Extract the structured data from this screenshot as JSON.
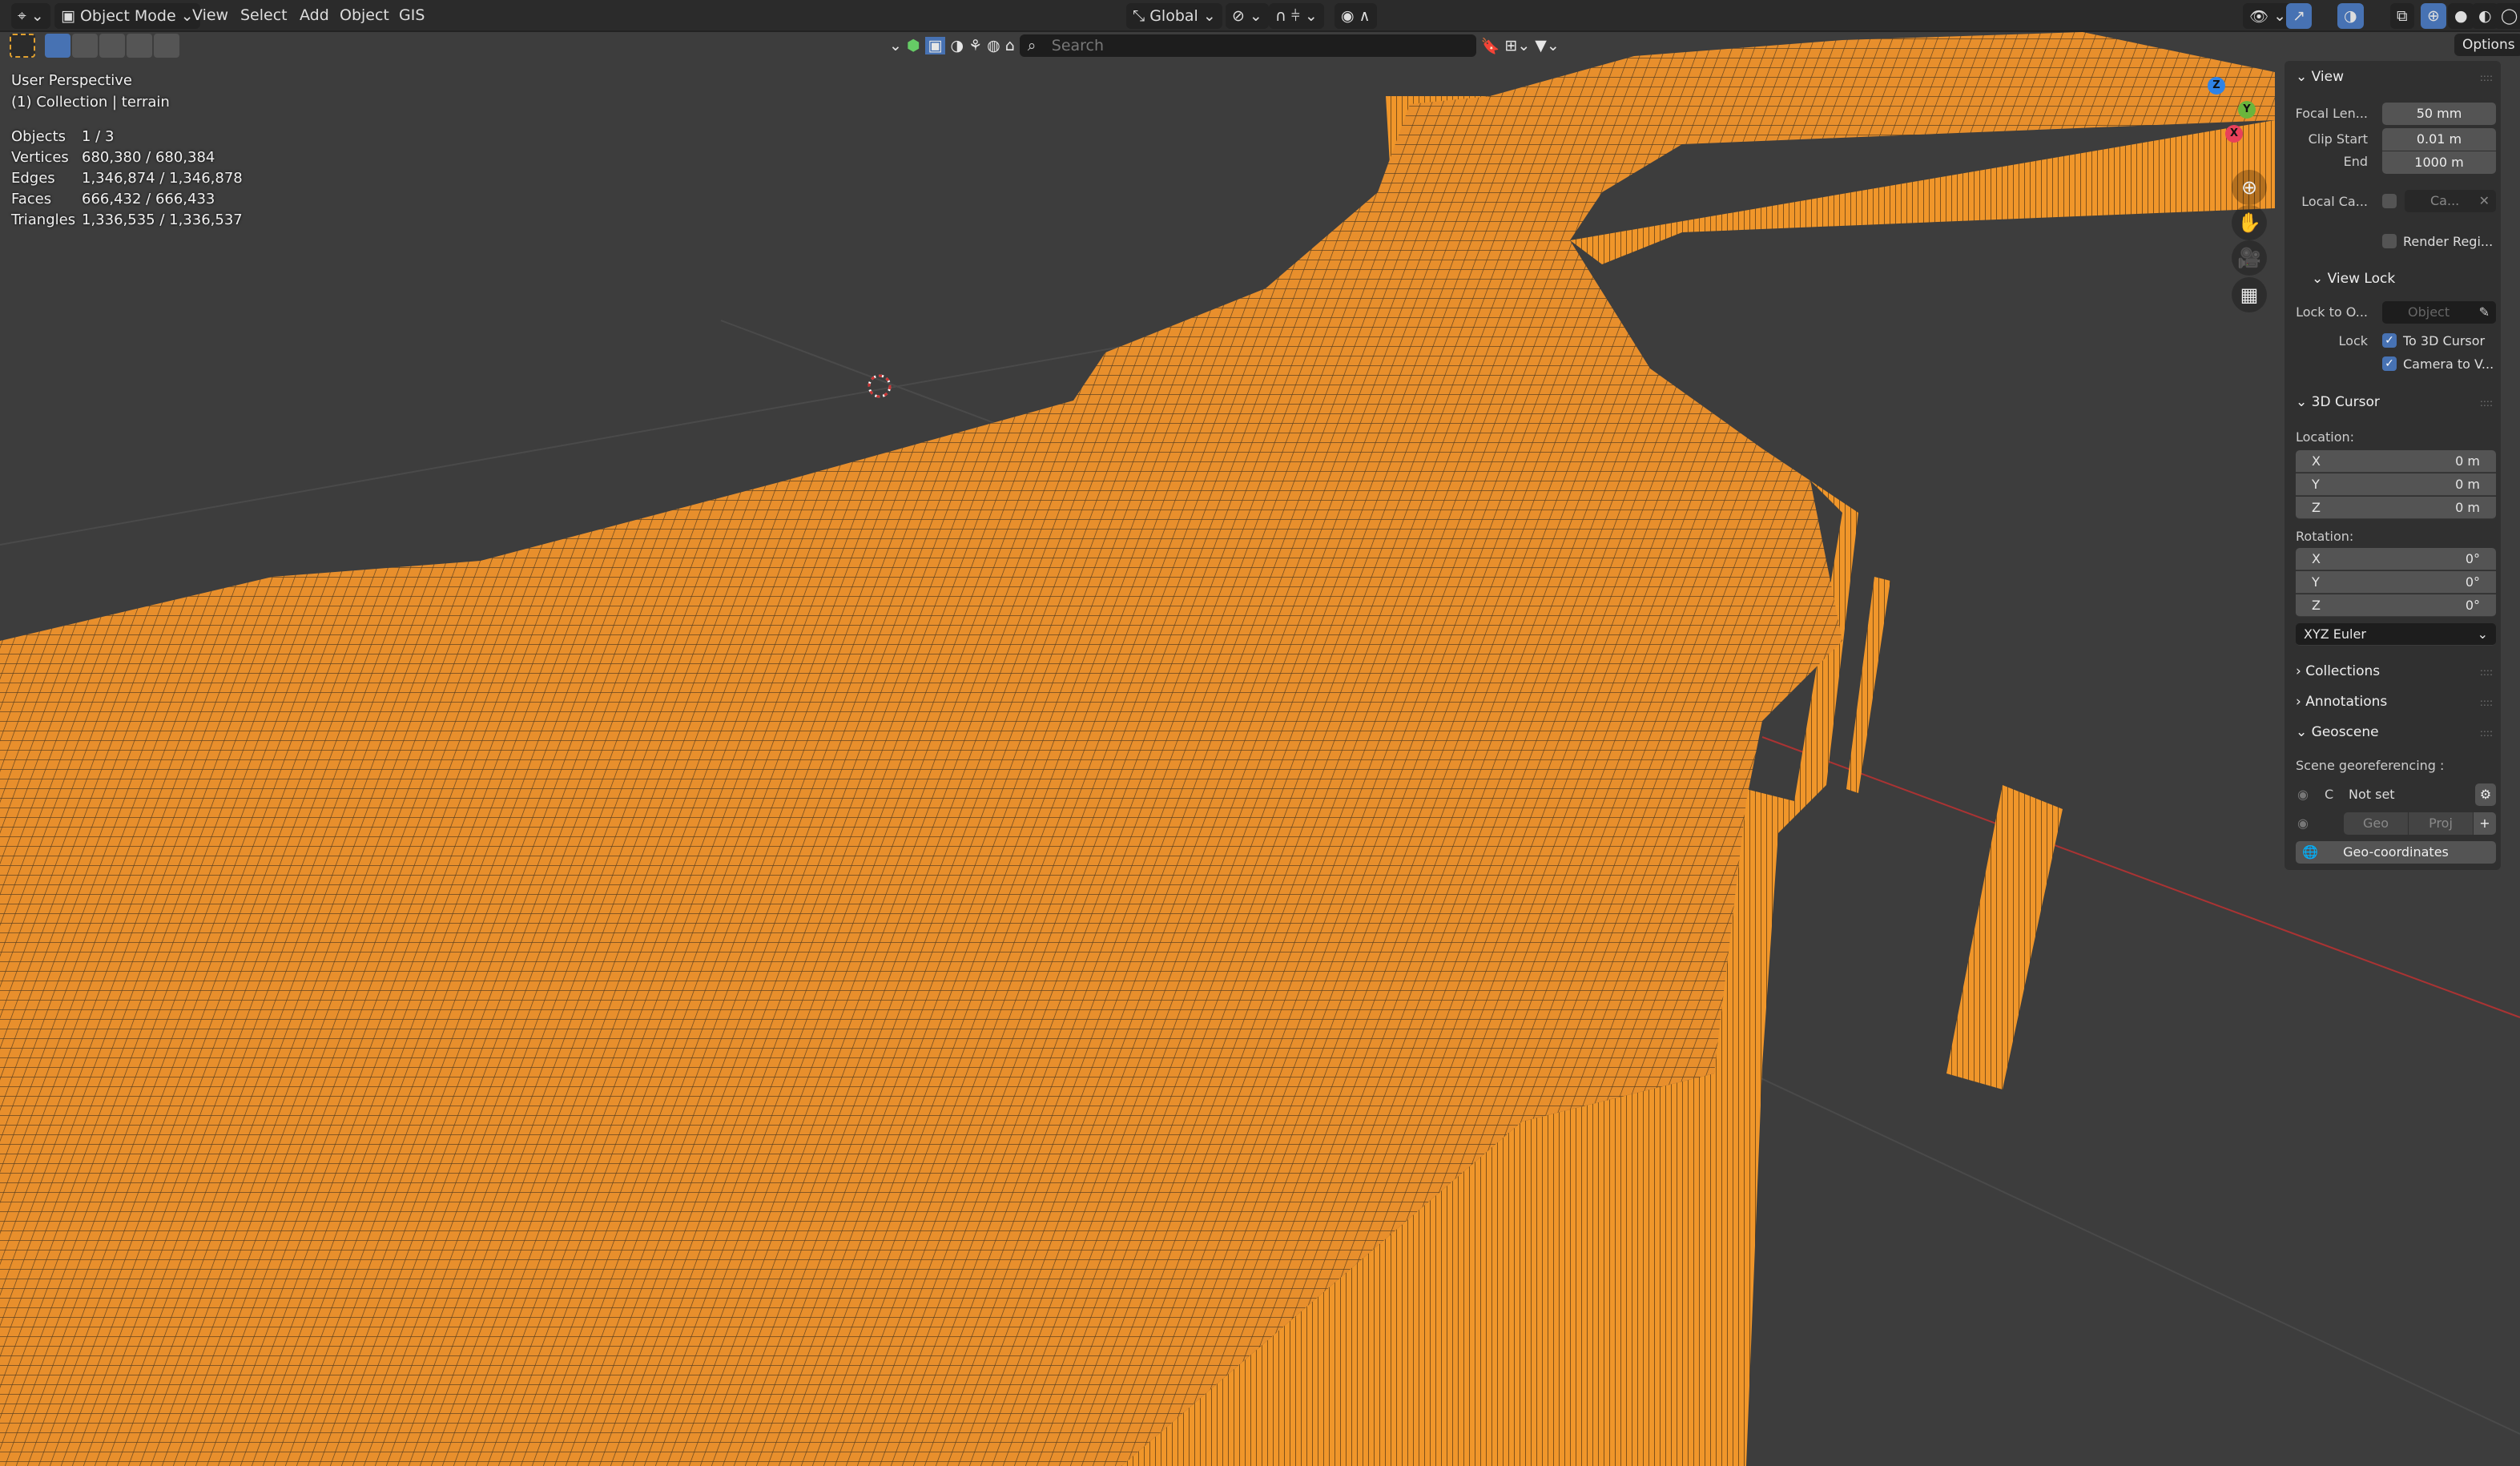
{
  "header": {
    "mode": "Object Mode",
    "menus": [
      "View",
      "Select",
      "Add",
      "Object",
      "GIS"
    ],
    "orientation": "Global"
  },
  "overlay": {
    "view_name": "User Perspective",
    "collection": "(1) Collection | terrain"
  },
  "stats": [
    {
      "label": "Objects",
      "value": "1 / 3"
    },
    {
      "label": "Vertices",
      "value": "680,380 / 680,384"
    },
    {
      "label": "Edges",
      "value": "1,346,874 / 1,346,878"
    },
    {
      "label": "Faces",
      "value": "666,432 / 666,433"
    },
    {
      "label": "Triangles",
      "value": "1,336,535 / 1,336,537"
    }
  ],
  "search": {
    "placeholder": "Search"
  },
  "options_label": "Options",
  "gizmo": {
    "x": "X",
    "y": "Y",
    "z": "Z"
  },
  "sidebar": {
    "view": {
      "title": "View",
      "focal_label": "Focal Len...",
      "focal": "50 mm",
      "clip_start_label": "Clip Start",
      "clip_start": "0.01 m",
      "end_label": "End",
      "end": "1000 m",
      "local_cam_label": "Local Ca...",
      "local_cam_value": "Ca...",
      "render_region": "Render Regi..."
    },
    "view_lock": {
      "title": "View Lock",
      "lock_to_label": "Lock to O...",
      "lock_to_placeholder": "Object",
      "lock_label": "Lock",
      "to_cursor": "To 3D Cursor",
      "camera_to_view": "Camera to V..."
    },
    "cursor": {
      "title": "3D Cursor",
      "location_label": "Location:",
      "location": [
        {
          "axis": "X",
          "value": "0 m"
        },
        {
          "axis": "Y",
          "value": "0 m"
        },
        {
          "axis": "Z",
          "value": "0 m"
        }
      ],
      "rotation_label": "Rotation:",
      "rotation": [
        {
          "axis": "X",
          "value": "0°"
        },
        {
          "axis": "Y",
          "value": "0°"
        },
        {
          "axis": "Z",
          "value": "0°"
        }
      ],
      "rotation_mode": "XYZ Euler"
    },
    "collections": "Collections",
    "annotations": "Annotations",
    "geoscene": {
      "title": "Geoscene",
      "georef_label": "Scene georeferencing :",
      "crs_prefix": "C",
      "crs_value": "Not set",
      "geo": "Geo",
      "proj": "Proj",
      "geo_coords": "Geo-coordinates"
    }
  },
  "colors": {
    "wire": "#f0962a",
    "background": "#3d3d3d",
    "accent": "#4772b3"
  }
}
